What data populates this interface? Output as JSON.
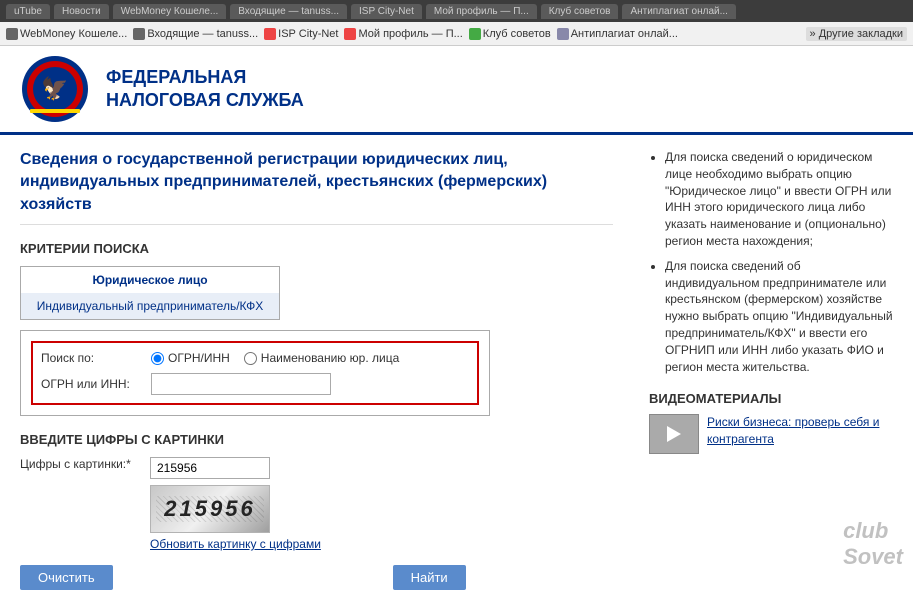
{
  "browser": {
    "tabs": [
      "uTube",
      "Новости",
      "WebMoney Кошеле...",
      "Входящие — tanuss...",
      "ISP City-Net",
      "Мой профиль — П...",
      "Клуб советов",
      "Антиплагиат онлай..."
    ],
    "bookmarks": [
      "WebMoney Кошеле...",
      "Входящие — tanuss...",
      "ISP City-Net",
      "Мой профиль — П...",
      "Клуб советов",
      "Антиплагиат онлай..."
    ],
    "other_bookmarks": "Другие закладки"
  },
  "header": {
    "logo_text_line1": "ФЕДЕРАЛЬНАЯ",
    "logo_text_line2": "НАЛОГОВАЯ СЛУЖБА"
  },
  "page": {
    "title": "Сведения о государственной регистрации юридических лиц, индивидуальных предпринимателей, крестьянских (фермерских) хозяйств"
  },
  "search": {
    "section_title": "КРИТЕРИИ ПОИСКА",
    "tab1": "Юридическое лицо",
    "tab2": "Индивидуальный предприниматель/КФХ",
    "search_by_label": "Поиск по:",
    "radio_ogrn": "ОГРН/ИНН",
    "radio_name": "Наименованию юр. лица",
    "ogrn_label": "ОГРН или ИНН:",
    "ogrn_value": ""
  },
  "captcha": {
    "section_title": "ВВЕДИТЕ ЦИФРЫ С КАРТИНКИ",
    "label": "Цифры с картинки:*",
    "value": "215956",
    "captcha_text": "215956",
    "refresh_link": "Обновить картинку с цифрами"
  },
  "buttons": {
    "clear": "Очистить",
    "search": "Найти"
  },
  "info_panel": {
    "bullets": [
      "Для поиска сведений о юридическом лице необходимо выбрать опцию \"Юридическое лицо\" и ввести ОГРН или ИНН этого юридического лица либо указать наименование и (опционально) регион места нахождения;",
      "Для поиска сведений об индивидуальном предпринимателе или крестьянском (фермерском) хозяйстве нужно выбрать опцию \"Индивидуальный предприниматель/КФХ\" и ввести его ОГРНИП или ИНН либо указать ФИО и регион места жительства."
    ]
  },
  "video": {
    "section_title": "ВИДЕОМАТЕРИАЛЫ",
    "link": "Риски бизнеса: проверь себя и контрагента"
  }
}
